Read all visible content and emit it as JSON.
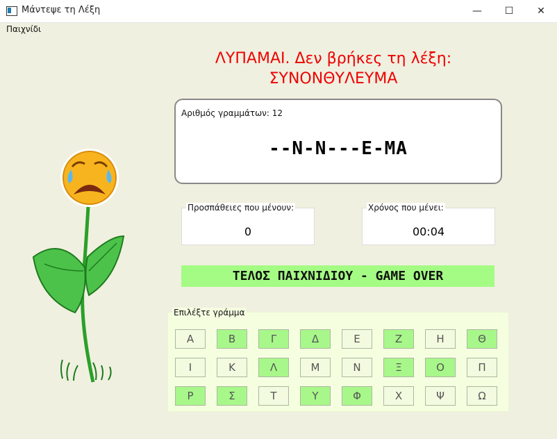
{
  "window": {
    "title": "Μάντεψε τη Λέξη",
    "minimize_glyph": "—",
    "maximize_glyph": "☐",
    "close_glyph": "✕"
  },
  "menu": {
    "items": [
      "Παιχνίδι"
    ]
  },
  "message": {
    "line1": "ΛΥΠΑΜΑΙ. Δεν βρήκες τη λέξη:",
    "line2": "ΣΥΝΟΝΘΥΛΕΥΜΑ",
    "color": "#ee0000"
  },
  "word_panel": {
    "letter_count_label": "Αριθμός γραμμάτων:",
    "letter_count": "12",
    "masked_word": "--N-N---E-MA"
  },
  "attempts": {
    "label": "Προσπάθειες που μένουν:",
    "value": "0"
  },
  "timer": {
    "label": "Χρόνος που μένει:",
    "value": "00:04"
  },
  "status_banner": {
    "text": "ΤΕΛΟΣ ΠΑΙΧΝΙΔΙΟΥ - GAME OVER",
    "color": "#a4fc84"
  },
  "letters": {
    "legend": "Επιλέξτε γράμμα",
    "buttons": [
      {
        "label": "Α",
        "used": false
      },
      {
        "label": "Β",
        "used": true
      },
      {
        "label": "Γ",
        "used": true
      },
      {
        "label": "Δ",
        "used": true
      },
      {
        "label": "Ε",
        "used": false
      },
      {
        "label": "Ζ",
        "used": true
      },
      {
        "label": "Η",
        "used": false
      },
      {
        "label": "Θ",
        "used": true
      },
      {
        "label": "Ι",
        "used": false
      },
      {
        "label": "Κ",
        "used": false
      },
      {
        "label": "Λ",
        "used": true
      },
      {
        "label": "Μ",
        "used": false
      },
      {
        "label": "Ν",
        "used": false
      },
      {
        "label": "Ξ",
        "used": true
      },
      {
        "label": "Ο",
        "used": true
      },
      {
        "label": "Π",
        "used": false
      },
      {
        "label": "Ρ",
        "used": true
      },
      {
        "label": "Σ",
        "used": true
      },
      {
        "label": "Τ",
        "used": false
      },
      {
        "label": "Υ",
        "used": true
      },
      {
        "label": "Φ",
        "used": true
      },
      {
        "label": "Χ",
        "used": false
      },
      {
        "label": "Ψ",
        "used": false
      },
      {
        "label": "Ω",
        "used": false
      }
    ],
    "used_color": "#a8f78a",
    "unused_color": "#f2fbdf"
  },
  "illustration": {
    "icon": "crying-flower-icon"
  }
}
